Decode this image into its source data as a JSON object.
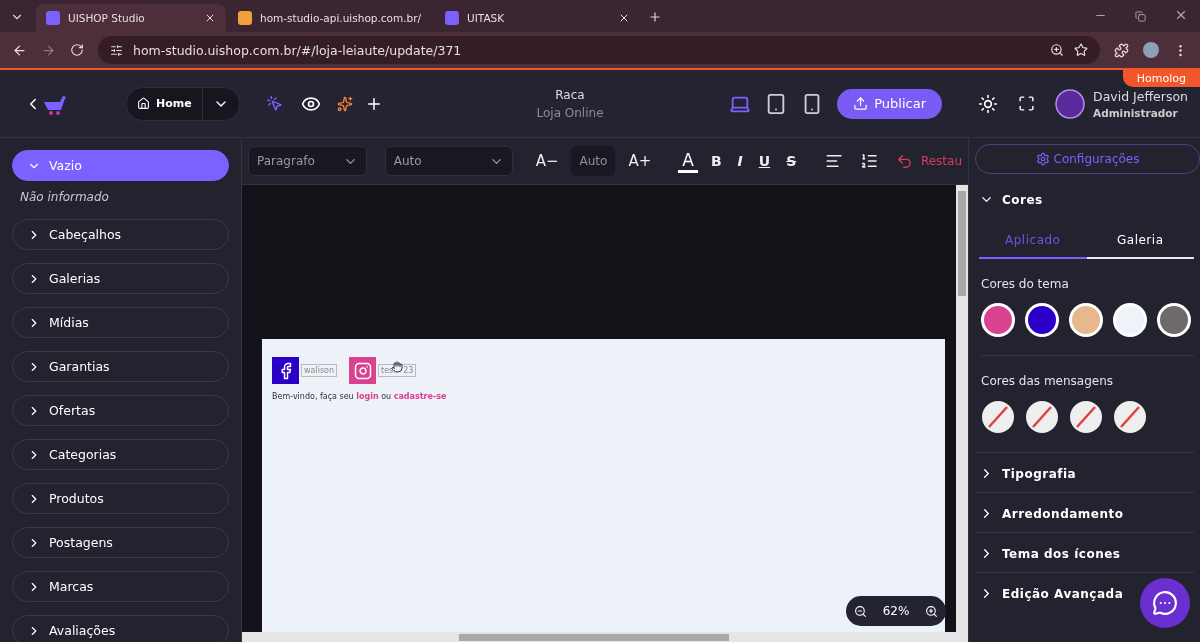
{
  "browser": {
    "tabs": [
      {
        "title": "UISHOP Studio",
        "selected": true
      },
      {
        "title": "hom-studio-api.uishop.com.br/",
        "selected": false
      },
      {
        "title": "UITASK",
        "selected": false
      }
    ],
    "url": "hom-studio.uishop.com.br/#/loja-leiaute/update/371"
  },
  "header": {
    "badge": "Homolog",
    "home": "Home",
    "store_name": "Raca",
    "store_type": "Loja Online",
    "devices": [
      {
        "kind": "desktop",
        "selected": true
      },
      {
        "kind": "tablet",
        "selected": false
      },
      {
        "kind": "phone",
        "selected": false
      }
    ],
    "publish": "Publicar",
    "user_name": "David Jefferson",
    "user_role": "Administrador"
  },
  "sidebar": {
    "active": {
      "label": "Vazio",
      "expanded": true
    },
    "note": "Não informado",
    "sections": [
      {
        "label": "Cabeçalhos"
      },
      {
        "label": "Galerias"
      },
      {
        "label": "Mídias"
      },
      {
        "label": "Garantias"
      },
      {
        "label": "Ofertas"
      },
      {
        "label": "Categorias"
      },
      {
        "label": "Produtos"
      },
      {
        "label": "Postagens"
      },
      {
        "label": "Marcas"
      },
      {
        "label": "Avaliações"
      }
    ]
  },
  "toolbar": {
    "block_type": "Paragrafo",
    "font": "Auto",
    "size": "Auto",
    "decrease": "A−",
    "increase": "A+",
    "color_letter": "A",
    "styles": [
      {
        "kind": "bold",
        "label": "B"
      },
      {
        "kind": "italic",
        "label": "I"
      },
      {
        "kind": "underline",
        "label": "U"
      },
      {
        "kind": "strike",
        "label": "S"
      }
    ],
    "restore": "Restau"
  },
  "canvas": {
    "social": [
      {
        "kind": "facebook",
        "label": "walison"
      },
      {
        "kind": "instagram",
        "label": "tes",
        "label_end": "23"
      }
    ],
    "welcome": [
      {
        "kind": "text",
        "text": "Bem-vindo, faça seu "
      },
      {
        "kind": "link",
        "text": "login"
      },
      {
        "kind": "text",
        "text": " ou "
      },
      {
        "kind": "link",
        "text": "cadastre-se"
      }
    ],
    "zoom": "62%"
  },
  "panel": {
    "settings": "Configurações",
    "colors": {
      "title": "Cores",
      "expanded": true,
      "tabs": [
        {
          "label": "Aplicado",
          "selected": true
        },
        {
          "label": "Galeria",
          "selected": false
        }
      ],
      "theme_label": "Cores do tema",
      "theme": [
        {
          "color": "#d9428f"
        },
        {
          "color": "#2a00c8"
        },
        {
          "color": "#e6b98d"
        },
        {
          "color": "#eef3fa"
        },
        {
          "color": "#6e6a6c"
        }
      ],
      "messages_label": "Cores das mensagens",
      "messages": [
        {
          "empty": true
        },
        {
          "empty": true
        },
        {
          "empty": true
        },
        {
          "empty": true
        }
      ]
    },
    "sections": [
      {
        "label": "Tipografia",
        "expanded": false
      },
      {
        "label": "Arredondamento",
        "expanded": false
      },
      {
        "label": "Tema dos ícones",
        "expanded": false
      },
      {
        "label": "Edição Avançada",
        "expanded": false
      }
    ]
  }
}
